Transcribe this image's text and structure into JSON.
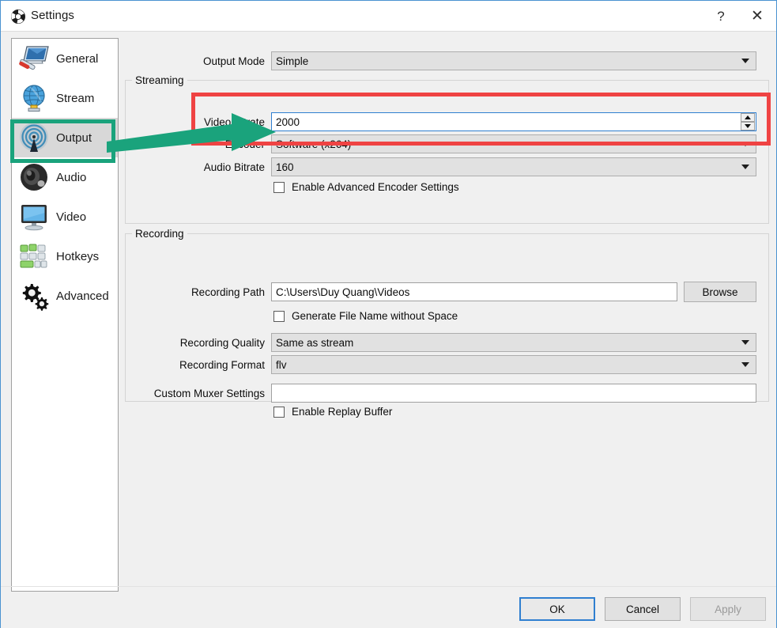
{
  "window": {
    "title": "Settings",
    "logo_icon": "obs-logo-icon",
    "help_label": "?",
    "close_label": "✕",
    "accent_blue": "#2f7fd0",
    "annotation_red": "#ef4343",
    "annotation_green": "#1aa37c"
  },
  "sidebar": {
    "items": [
      {
        "label": "General",
        "icon": "general-icon",
        "selected": false
      },
      {
        "label": "Stream",
        "icon": "stream-icon",
        "selected": false
      },
      {
        "label": "Output",
        "icon": "output-icon",
        "selected": true
      },
      {
        "label": "Audio",
        "icon": "audio-icon",
        "selected": false
      },
      {
        "label": "Video",
        "icon": "video-icon",
        "selected": false
      },
      {
        "label": "Hotkeys",
        "icon": "hotkeys-icon",
        "selected": false
      },
      {
        "label": "Advanced",
        "icon": "advanced-icon",
        "selected": false
      }
    ]
  },
  "main": {
    "output_mode": {
      "label": "Output Mode",
      "value": "Simple"
    },
    "streaming": {
      "group_title": "Streaming",
      "video_bitrate": {
        "label": "Video Bitrate",
        "value": "2000"
      },
      "encoder": {
        "label": "Encoder",
        "value": "Software (x264)"
      },
      "audio_bitrate": {
        "label": "Audio Bitrate",
        "value": "160"
      },
      "advanced_encoder": {
        "label": "Enable Advanced Encoder Settings",
        "checked": false
      }
    },
    "recording": {
      "group_title": "Recording",
      "recording_path": {
        "label": "Recording Path",
        "value": "C:\\Users\\Duy Quang\\Videos"
      },
      "browse_label": "Browse",
      "generate_no_space": {
        "label": "Generate File Name without Space",
        "checked": false
      },
      "recording_quality": {
        "label": "Recording Quality",
        "value": "Same as stream"
      },
      "recording_format": {
        "label": "Recording Format",
        "value": "flv"
      },
      "custom_muxer": {
        "label": "Custom Muxer Settings",
        "value": "",
        "placeholder": ""
      },
      "replay_buffer": {
        "label": "Enable Replay Buffer",
        "checked": false
      }
    }
  },
  "footer": {
    "ok_label": "OK",
    "cancel_label": "Cancel",
    "apply_label": "Apply"
  }
}
